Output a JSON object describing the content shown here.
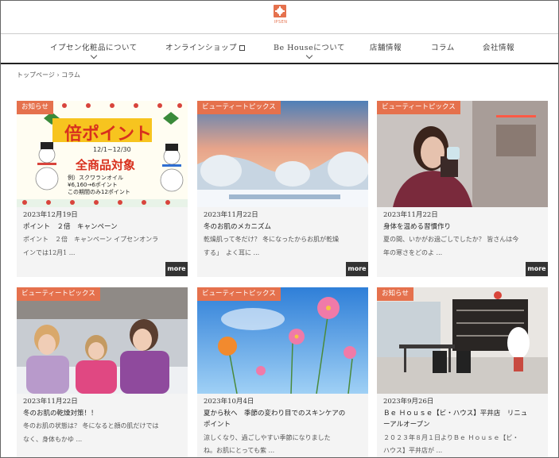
{
  "brand": {
    "logo_text": "IPSEN"
  },
  "nav": {
    "items": [
      {
        "label": "イプセン化粧品について"
      },
      {
        "label": "オンラインショップ"
      },
      {
        "label": "Be Houseについて"
      },
      {
        "label": "店舗情報"
      },
      {
        "label": "コラム"
      },
      {
        "label": "会社情報"
      }
    ]
  },
  "breadcrumb": "トップページ › コラム",
  "more_label": "more",
  "promo": {
    "headline": "倍ポイント",
    "period": "12/1~12/30",
    "target": "全商品対象",
    "example_prefix": "例）",
    "example_product": "スクワランオイル",
    "example_calc": "¥6,160→6ポイント",
    "example_note": "この期間のみ12ポイント"
  },
  "cards": [
    {
      "tag": "お知らせ",
      "date": "2023年12月19日",
      "title": "ポイント　２倍　キャンペーン",
      "excerpt_1": "ポイント　２倍　キャンペーン イプセンオンラ",
      "excerpt_2": "インでは12月1 ...",
      "has_more": true
    },
    {
      "tag": "ビューティートピックス",
      "date": "2023年11月22日",
      "title": "冬のお肌のメカニズム",
      "excerpt_1": "乾燥肌って冬だけ？ 冬になったからお肌が乾燥",
      "excerpt_2": "する」　よく耳に ...",
      "has_more": true
    },
    {
      "tag": "ビューティートピックス",
      "date": "2023年11月22日",
      "title": "身体を温める習慣作り",
      "excerpt_1": "夏の間、いかがお過ごしでしたか？ 皆さんは今",
      "excerpt_2": "年の寒さをどのよ ...",
      "has_more": true
    },
    {
      "tag": "ビューティートピックス",
      "date": "2023年11月22日",
      "title": "冬のお肌の乾燥対策！！",
      "excerpt_1": "冬のお肌の状態は？ 冬になると顔の肌だけでは",
      "excerpt_2": "なく、身体もかゆ ...",
      "has_more": false
    },
    {
      "tag": "ビューティートピックス",
      "date": "2023年10月4日",
      "title": "夏から秋へ　季節の変わり目でのスキンケアの",
      "title_2": "ポイント",
      "excerpt_1": "涼しくなり、過ごしやすい季節になりました",
      "excerpt_2": "ね。お肌にとっても紫 ...",
      "has_more": false
    },
    {
      "tag": "お知らせ",
      "date": "2023年9月26日",
      "title": "Ｂｅ Ｈｏｕｓｅ【ビ・ハウス】平井店　リニュ",
      "title_2": "ーアルオープン",
      "excerpt_1": "２０２３年８月１日よりＢｅ Ｈｏｕｓｅ【ビ・",
      "excerpt_2": "ハウス】平井店が ...",
      "has_more": false
    }
  ]
}
